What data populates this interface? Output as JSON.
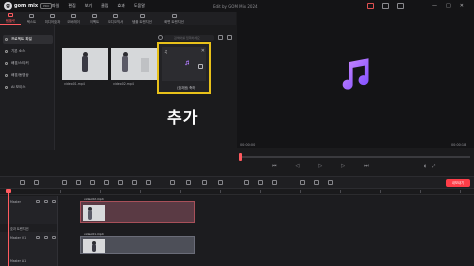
{
  "app": {
    "logo_text": "gom mix",
    "logo_badge": "PRO",
    "window_title": "Edit by GOM Mix 2024",
    "menu": [
      "파일",
      "편집",
      "보기",
      "클립",
      "효과",
      "도움말"
    ]
  },
  "tabs": [
    {
      "label": "템플릿",
      "active": true
    },
    {
      "label": "텍스트",
      "active": false
    },
    {
      "label": "미디어효과",
      "active": false
    },
    {
      "label": "오버레이",
      "active": false
    },
    {
      "label": "이펙트",
      "active": false
    },
    {
      "label": "오디오믹서",
      "active": false
    },
    {
      "label": "템플 트랜지션",
      "active": false
    },
    {
      "label": "화면 트랜지션",
      "active": false
    }
  ],
  "sidebar": {
    "items": [
      {
        "label": "프로젝트 파일",
        "active": true
      },
      {
        "label": "기본 소스",
        "active": false
      },
      {
        "label": "배경/스티커",
        "active": false
      },
      {
        "label": "배경/동영상",
        "active": false
      },
      {
        "label": "AI 보이스",
        "active": false
      }
    ]
  },
  "media": {
    "search_placeholder": "검색어를 입력하세요",
    "items": [
      {
        "name": "video01.mp4"
      },
      {
        "name": "video02.mp4"
      }
    ],
    "audio_card": {
      "name": "(효과음) 축하"
    }
  },
  "overlay_label": "추가",
  "player": {
    "time_current": "00:00:00",
    "time_total": "00:00:18"
  },
  "timeline": {
    "export_label": "내보내기",
    "tracks": [
      {
        "name": "Master",
        "clip": "video02.mp4"
      },
      {
        "name": "효과 트랜지션"
      },
      {
        "name": "Master V1",
        "clip": "video01.mp4"
      },
      {
        "name": "Master A1"
      }
    ]
  },
  "colors": {
    "accent": "#ff5a5f",
    "highlight": "#e8c11a",
    "note_gradient_start": "#c77dff",
    "note_gradient_end": "#7b4cff"
  }
}
